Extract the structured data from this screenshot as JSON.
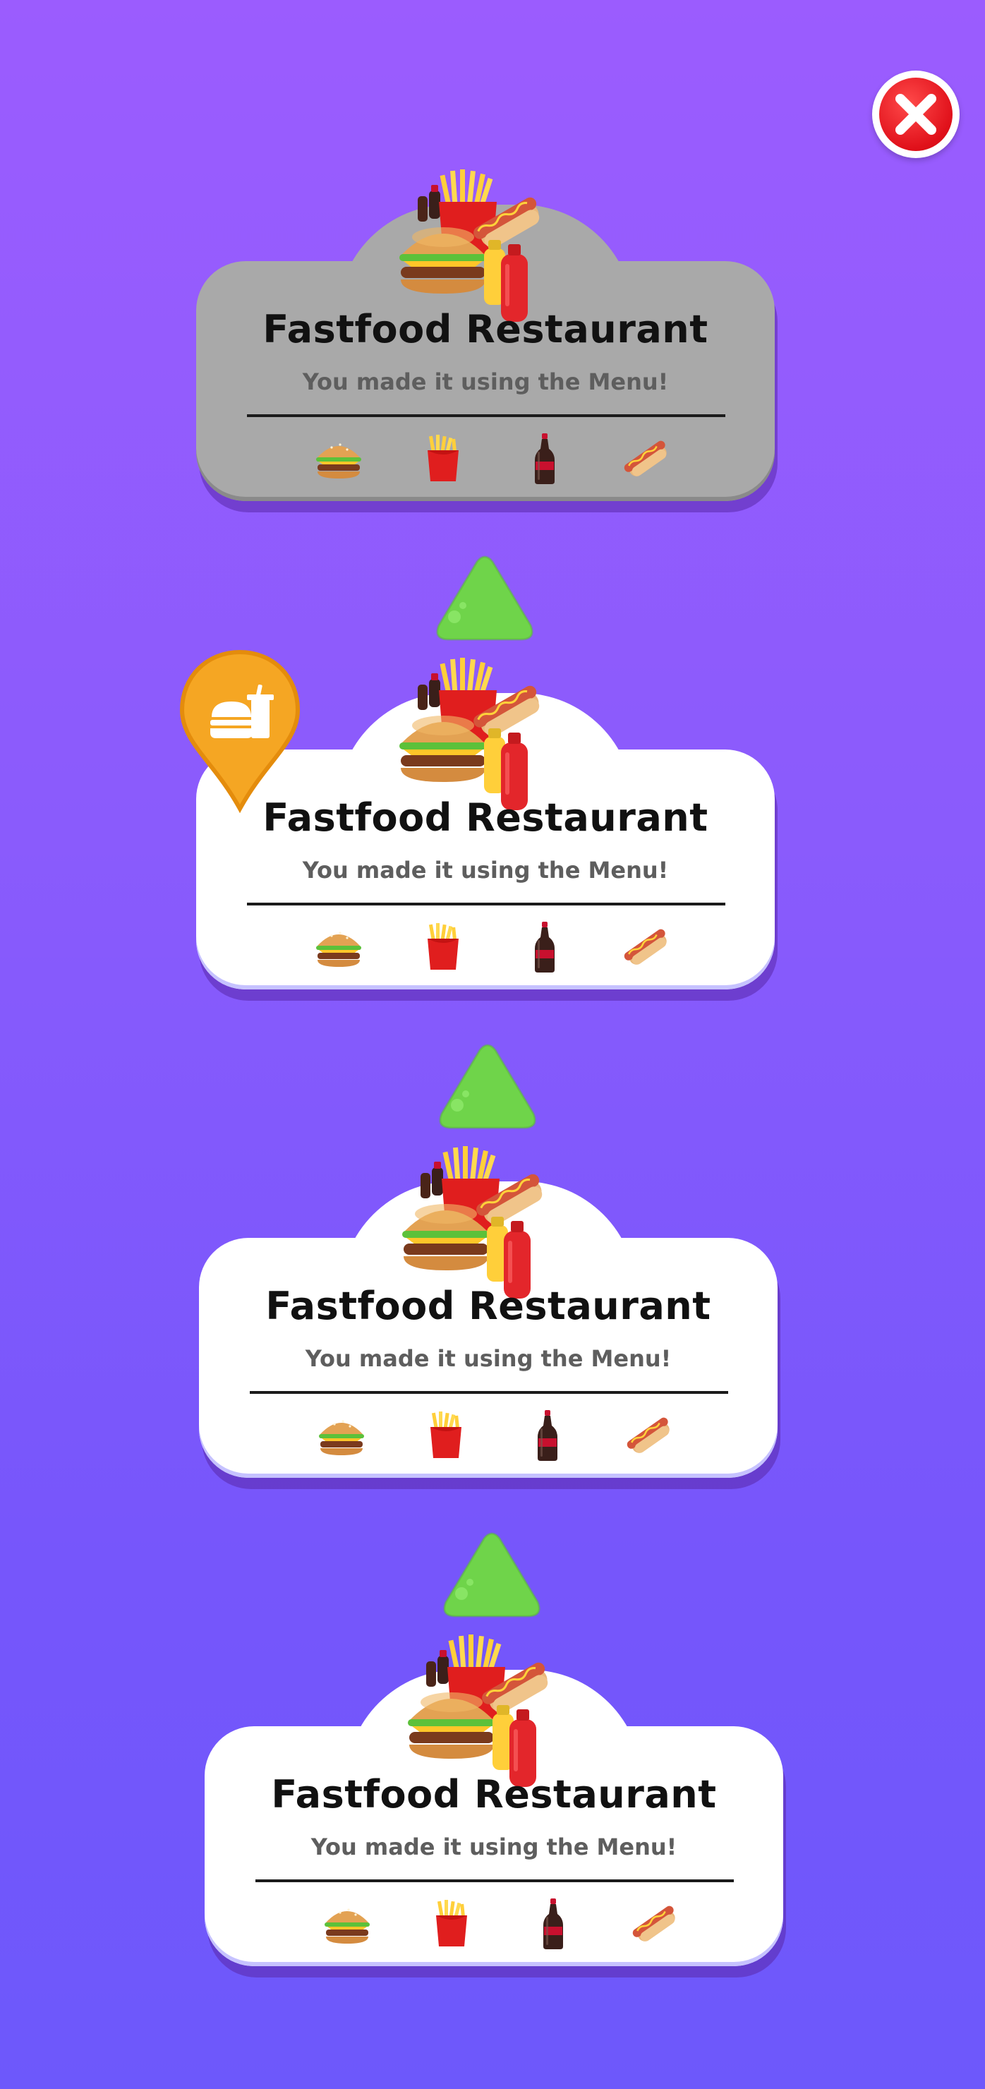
{
  "screen": "level-select",
  "colors": {
    "background_top": "#9b5cfe",
    "background_bottom": "#6d58fb",
    "locked_card": "#a9a9a9",
    "unlocked_card": "#ffffff",
    "path_arrow": "#6fd44a",
    "location_pin": "#f5a623",
    "close_button": "#e0101a"
  },
  "close_button": {
    "icon": "close-x-icon"
  },
  "current_location_pin": {
    "icon": "fastfood-pin-icon"
  },
  "levels": [
    {
      "title": "Fastfood Restaurant",
      "subtitle": "You made it using the Menu!",
      "state": "locked",
      "hero_icon": "fastfood-combo-icon",
      "foods": [
        "burger-icon",
        "fries-icon",
        "cola-bottle-icon",
        "hotdog-icon"
      ]
    },
    {
      "title": "Fastfood Restaurant",
      "subtitle": "You made it using the Menu!",
      "state": "current",
      "hero_icon": "fastfood-combo-icon",
      "foods": [
        "burger-icon",
        "fries-icon",
        "cola-bottle-icon",
        "hotdog-icon"
      ]
    },
    {
      "title": "Fastfood Restaurant",
      "subtitle": "You made it using the Menu!",
      "state": "completed",
      "hero_icon": "fastfood-combo-icon",
      "foods": [
        "burger-icon",
        "fries-icon",
        "cola-bottle-icon",
        "hotdog-icon"
      ]
    },
    {
      "title": "Fastfood Restaurant",
      "subtitle": "You made it using the Menu!",
      "state": "completed",
      "hero_icon": "fastfood-combo-icon",
      "foods": [
        "burger-icon",
        "fries-icon",
        "cola-bottle-icon",
        "hotdog-icon"
      ]
    }
  ],
  "path_arrows": [
    {
      "icon": "up-arrow-icon"
    },
    {
      "icon": "up-arrow-icon"
    },
    {
      "icon": "up-arrow-icon"
    }
  ]
}
